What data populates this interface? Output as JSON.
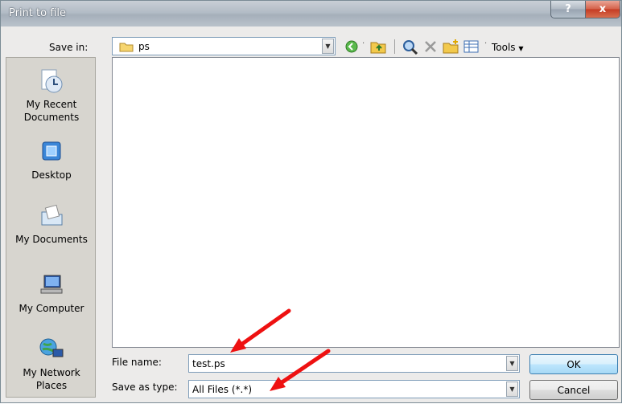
{
  "window": {
    "title": "Print to file",
    "help_glyph": "?",
    "close_glyph": "x"
  },
  "toolbar": {
    "save_in_label": "Save in:",
    "save_in_value": "ps",
    "tools_label": "Tools",
    "icons": [
      "back-icon",
      "up-folder-icon",
      "search-web-icon",
      "delete-icon",
      "new-folder-icon",
      "views-icon"
    ]
  },
  "places": [
    {
      "label": "My Recent Documents",
      "icon": "recent-documents-icon"
    },
    {
      "label": "Desktop",
      "icon": "desktop-icon"
    },
    {
      "label": "My Documents",
      "icon": "my-documents-icon"
    },
    {
      "label": "My Computer",
      "icon": "my-computer-icon"
    },
    {
      "label": "My Network Places",
      "icon": "network-places-icon"
    }
  ],
  "form": {
    "file_name_label": "File name:",
    "file_name_value": "test.ps",
    "save_as_type_label": "Save as type:",
    "save_as_type_value": "All Files (*.*)"
  },
  "buttons": {
    "ok": "OK",
    "cancel": "Cancel"
  },
  "colors": {
    "annotation_arrow": "#ee1111",
    "accent": "#3c7fb1"
  }
}
